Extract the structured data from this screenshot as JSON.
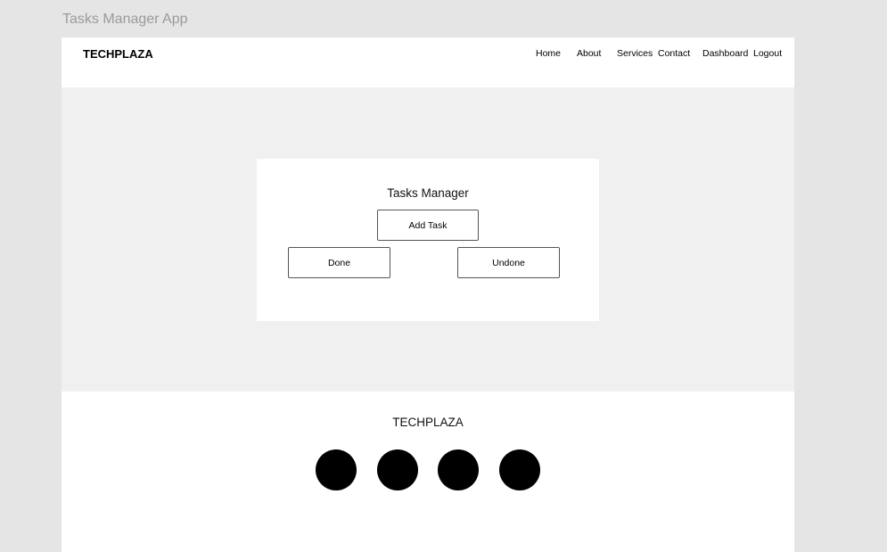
{
  "window": {
    "title": "Tasks Manager App"
  },
  "navbar": {
    "brand": "TECHPLAZA",
    "links": [
      {
        "label": "Home"
      },
      {
        "label": "About"
      },
      {
        "label": "Services"
      },
      {
        "label": "Contact"
      },
      {
        "label": "Dashboard"
      },
      {
        "label": "Logout"
      }
    ]
  },
  "card": {
    "title": "Tasks Manager",
    "add_task_label": "Add Task",
    "done_label": "Done",
    "undone_label": "Undone"
  },
  "footer": {
    "brand": "TECHPLAZA",
    "social_icons": [
      "social-icon-1",
      "social-icon-2",
      "social-icon-3",
      "social-icon-4"
    ]
  }
}
